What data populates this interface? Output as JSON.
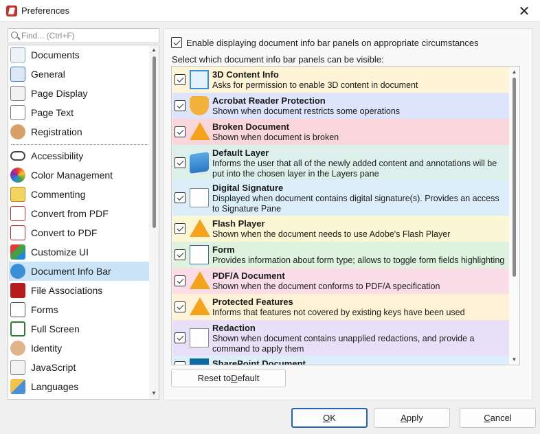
{
  "window": {
    "title": "Preferences"
  },
  "search": {
    "placeholder": "Find... (Ctrl+F)"
  },
  "nav": {
    "items": [
      {
        "label": "Documents",
        "icon": "documents-icon"
      },
      {
        "label": "General",
        "icon": "general-icon"
      },
      {
        "label": "Page Display",
        "icon": "page-display-icon"
      },
      {
        "label": "Page Text",
        "icon": "page-text-icon"
      },
      {
        "label": "Registration",
        "icon": "registration-icon"
      },
      {
        "label": "Accessibility",
        "icon": "accessibility-icon"
      },
      {
        "label": "Color Management",
        "icon": "color-management-icon"
      },
      {
        "label": "Commenting",
        "icon": "commenting-icon"
      },
      {
        "label": "Convert from PDF",
        "icon": "convert-from-pdf-icon"
      },
      {
        "label": "Convert to PDF",
        "icon": "convert-to-pdf-icon"
      },
      {
        "label": "Customize UI",
        "icon": "customize-ui-icon"
      },
      {
        "label": "Document Info Bar",
        "icon": "document-info-bar-icon",
        "selected": true
      },
      {
        "label": "File Associations",
        "icon": "file-associations-icon"
      },
      {
        "label": "Forms",
        "icon": "forms-icon"
      },
      {
        "label": "Full Screen",
        "icon": "full-screen-icon"
      },
      {
        "label": "Identity",
        "icon": "identity-icon"
      },
      {
        "label": "JavaScript",
        "icon": "javascript-icon"
      },
      {
        "label": "Languages",
        "icon": "languages-icon"
      }
    ]
  },
  "panel": {
    "enable_label": "Enable displaying document info bar panels on appropriate circumstances",
    "enable_checked": true,
    "select_label": "Select which document info bar panels can be visible:",
    "items": [
      {
        "title": "3D Content Info",
        "desc": "Asks for permission to enable 3D content in document",
        "checked": true,
        "bg": "#fff4d6",
        "icon": "cube-icon"
      },
      {
        "title": "Acrobat Reader Protection",
        "desc": "Shown when document restricts some operations",
        "checked": true,
        "bg": "#dde4fb",
        "icon": "shield-icon"
      },
      {
        "title": "Broken Document",
        "desc": "Shown when document is broken",
        "checked": true,
        "bg": "#f9d6d9",
        "icon": "warning-icon"
      },
      {
        "title": "Default Layer",
        "desc": "Informs the user that all of the newly added content and annotations will be put into the chosen layer in the Layers pane",
        "checked": true,
        "bg": "#dcefea",
        "icon": "layers-icon"
      },
      {
        "title": "Digital Signature",
        "desc": "Displayed when document contains digital signature(s). Provides an access to Signature Pane",
        "checked": true,
        "bg": "#ddeefb",
        "icon": "certificate-icon"
      },
      {
        "title": "Flash Player",
        "desc": "Shown when the document needs to use Adobe's Flash Player",
        "checked": true,
        "bg": "#fbf7d4",
        "icon": "warning-icon"
      },
      {
        "title": "Form",
        "desc": "Provides information about form type; allows to toggle form fields highlighting",
        "checked": true,
        "bg": "#dff2dd",
        "icon": "form-icon"
      },
      {
        "title": "PDF/A Document",
        "desc": "Shown when the document conforms to PDF/A specification",
        "checked": true,
        "bg": "#fbdde8",
        "icon": "warning-icon"
      },
      {
        "title": "Protected Features",
        "desc": "Informs that features not covered by existing keys have been used",
        "checked": true,
        "bg": "#fff2d6",
        "icon": "warning-icon"
      },
      {
        "title": "Redaction",
        "desc": "Shown when document contains unapplied redactions, and provide a command to apply them",
        "checked": true,
        "bg": "#e8e0f8",
        "icon": "redaction-icon"
      },
      {
        "title": "SharePoint Document",
        "desc": "",
        "checked": true,
        "bg": "#ddeefb",
        "icon": "sharepoint-icon"
      }
    ],
    "reset_button": {
      "pre": "Reset to ",
      "accel": "D",
      "post": "efault"
    }
  },
  "footer": {
    "ok": {
      "accel": "O",
      "post": "K"
    },
    "apply": {
      "accel": "A",
      "post": "pply"
    },
    "cancel": {
      "accel": "C",
      "post": "ancel"
    }
  }
}
